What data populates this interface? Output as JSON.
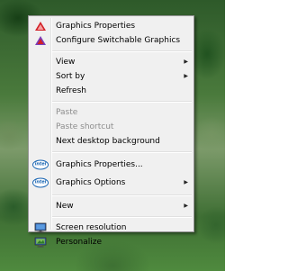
{
  "menu": {
    "graphics_properties_top": "Graphics Properties",
    "configure_switchable": "Configure Switchable Graphics",
    "view": "View",
    "sort_by": "Sort by",
    "refresh": "Refresh",
    "paste": "Paste",
    "paste_shortcut": "Paste shortcut",
    "next_desktop_background": "Next desktop background",
    "graphics_properties_intel": "Graphics Properties...",
    "graphics_options": "Graphics Options",
    "new": "New",
    "screen_resolution": "Screen resolution",
    "personalize": "Personalize",
    "submenu_arrow": "▶",
    "intel_logo": "intel"
  },
  "icons": {
    "amd_red": "#d21f26",
    "configure_purple": "#7a3db8",
    "intel_blue": "#1a66b3"
  }
}
